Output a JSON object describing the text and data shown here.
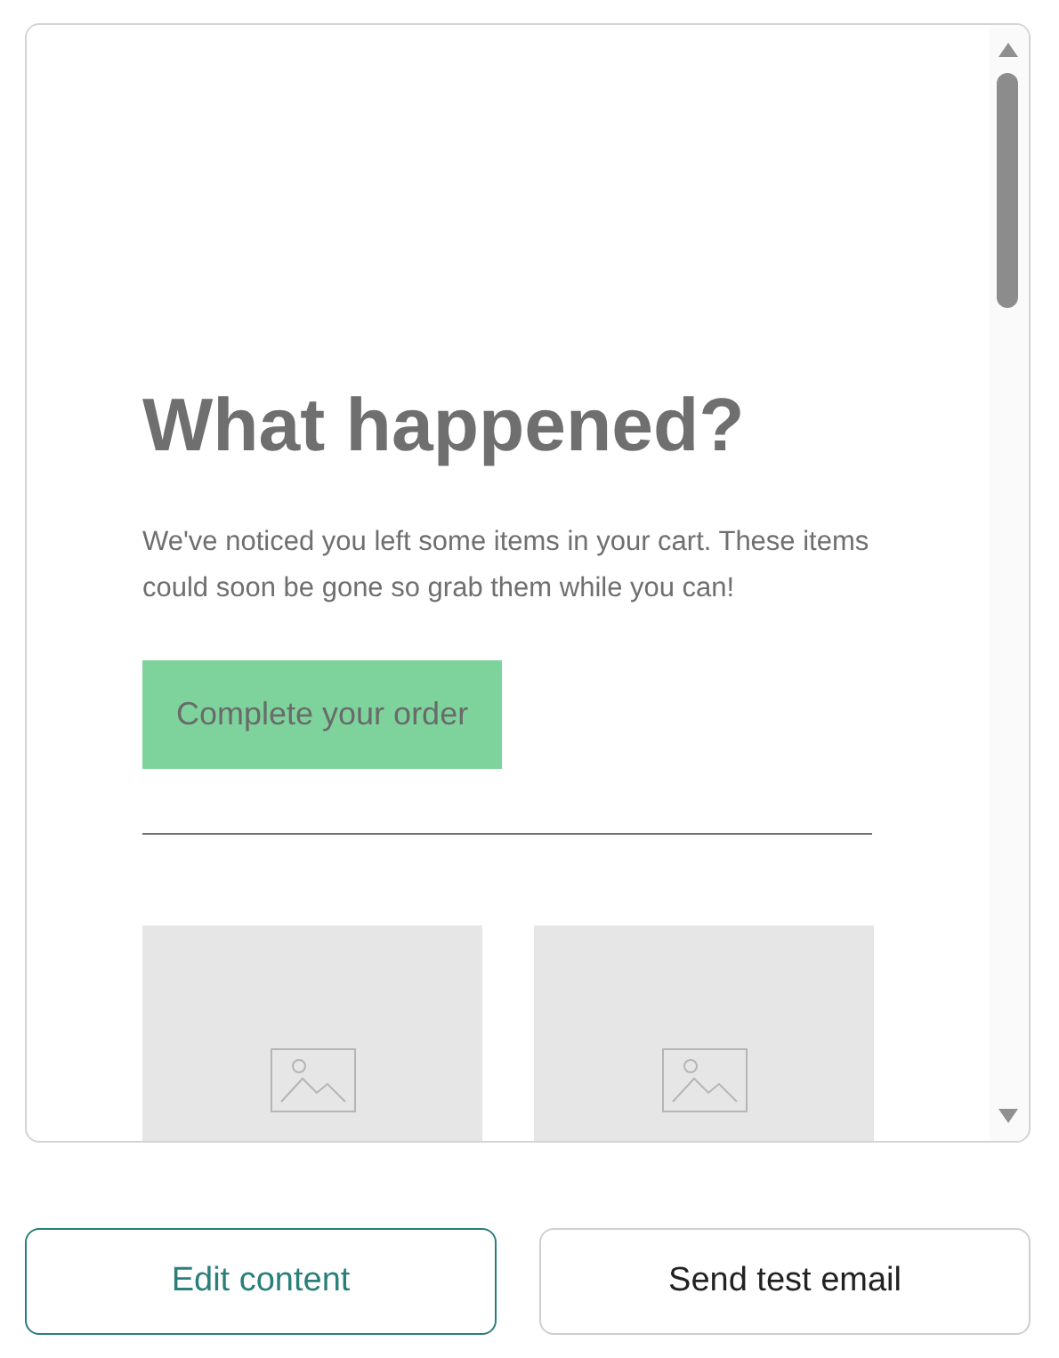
{
  "email_preview": {
    "heading": "What happened?",
    "body": "We've noticed you left some items in your cart. These items could soon be gone so grab them while you can!",
    "cta_button": "Complete your order",
    "products": [
      {
        "kind": "image_placeholder"
      },
      {
        "kind": "image_placeholder"
      }
    ]
  },
  "buttons": [
    {
      "label": "Edit content",
      "kind": "primary"
    },
    {
      "label": "Send test email",
      "kind": "secondary"
    }
  ]
}
